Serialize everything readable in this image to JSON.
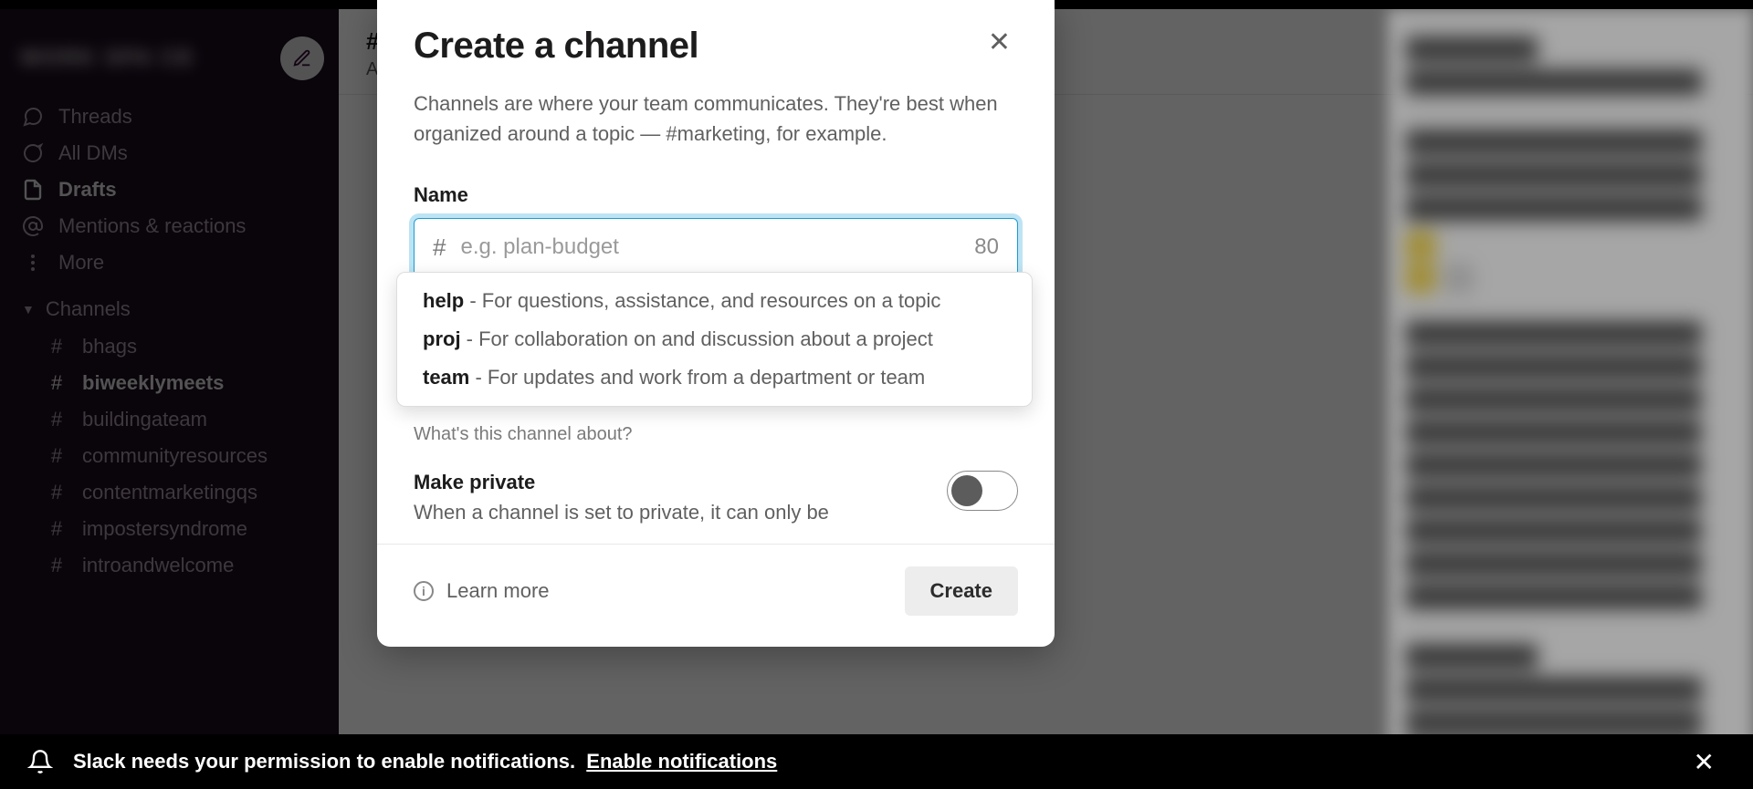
{
  "sidebar": {
    "workspace_name": "WORK SPA CE",
    "nav": [
      {
        "label": "Threads",
        "icon": "threads"
      },
      {
        "label": "All DMs",
        "icon": "dms"
      },
      {
        "label": "Drafts",
        "icon": "drafts",
        "strong": true
      },
      {
        "label": "Mentions & reactions",
        "icon": "mentions"
      },
      {
        "label": "More",
        "icon": "more"
      }
    ],
    "channels_header": "Channels",
    "channels": [
      {
        "name": "bhags"
      },
      {
        "name": "biweeklymeets",
        "strong": true
      },
      {
        "name": "buildingateam"
      },
      {
        "name": "communityresources"
      },
      {
        "name": "contentmarketingqs"
      },
      {
        "name": "impostersyndrome"
      },
      {
        "name": "introandwelcome"
      }
    ]
  },
  "main_header": {
    "title_prefix": "#",
    "subline_first_char": "A"
  },
  "notification": {
    "text": "Slack needs your permission to enable notifications.",
    "link": "Enable notifications"
  },
  "modal": {
    "title": "Create a channel",
    "description": "Channels are where your team communicates. They're best when organized around a topic — #marketing, for example.",
    "name_label": "Name",
    "name_placeholder": "e.g. plan-budget",
    "name_counter": "80",
    "about_hint": "What's this channel about?",
    "private_title": "Make private",
    "private_desc": "When a channel is set to private, it can only be",
    "learn_more": "Learn more",
    "create": "Create",
    "suggestions": [
      {
        "prefix": "help",
        "desc": " - For questions, assistance, and resources on a topic"
      },
      {
        "prefix": "proj",
        "desc": " - For collaboration on and discussion about a project"
      },
      {
        "prefix": "team",
        "desc": " - For updates and work from a department or team"
      }
    ]
  }
}
